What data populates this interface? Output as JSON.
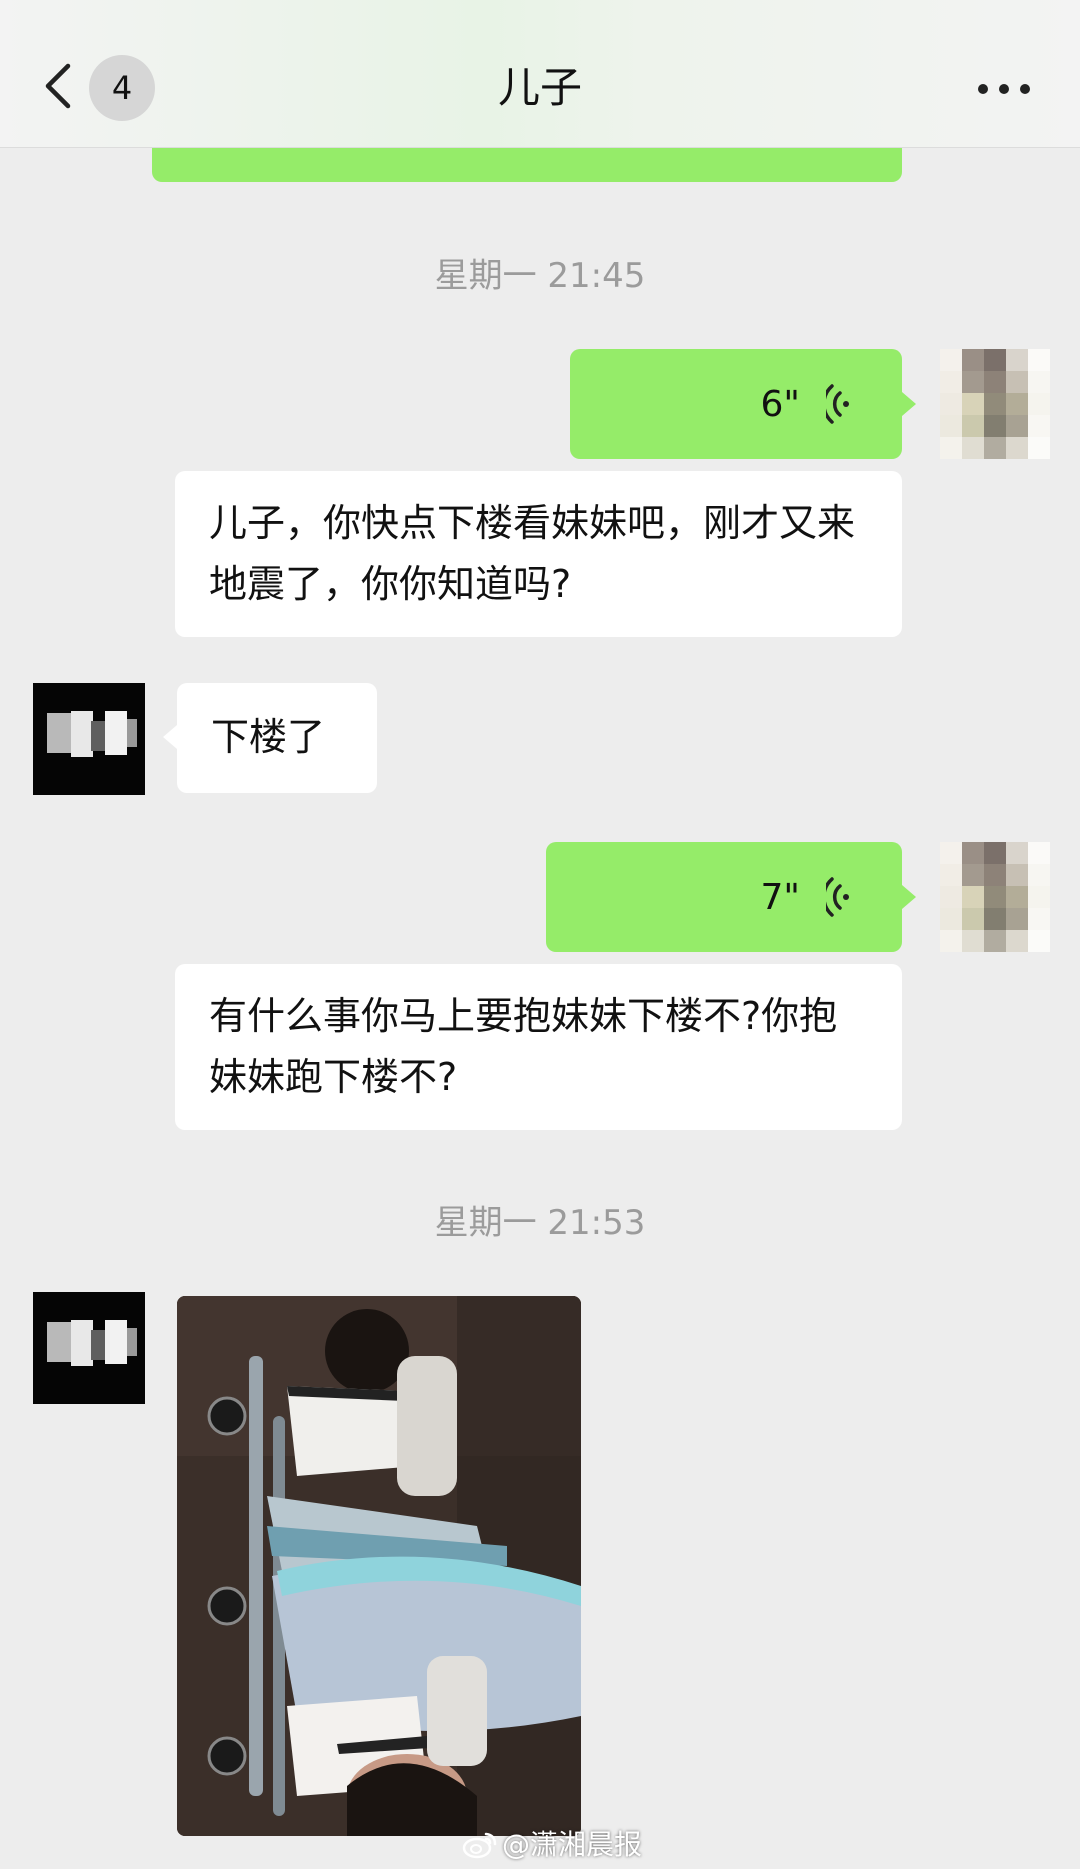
{
  "header": {
    "unread_count": "4",
    "title": "儿子",
    "icons": [
      "back-arrow-icon",
      "more-dots-icon"
    ]
  },
  "messages": {
    "time_1": "星期一 21:45",
    "voice_1": {
      "duration": "6\""
    },
    "text_1": "儿子，你快点下楼看妹妹吧，刚才又来地震了，你你知道吗?",
    "reply_1": "下楼了",
    "voice_2": {
      "duration": "7\""
    },
    "text_2": "有什么事你马上要抱妹妹下楼不?你抱妹妹跑下楼不?",
    "time_2": "星期一 21:53"
  },
  "watermark": {
    "text": "@潇湘晨报",
    "icon": "weibo-icon"
  },
  "colors": {
    "background": "#ededed",
    "sent_bubble": "#95ec69",
    "received_bubble": "#ffffff",
    "timestamp": "#9b9b9b"
  }
}
